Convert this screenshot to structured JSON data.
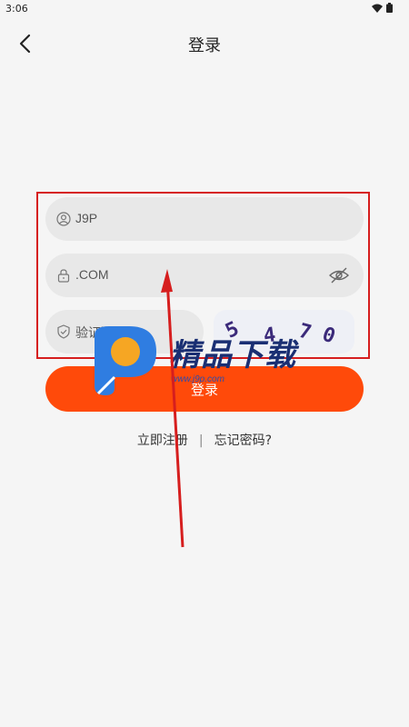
{
  "status_bar": {
    "time": "3:06",
    "icons": [
      "wifi-icon",
      "battery-icon"
    ]
  },
  "header": {
    "back_icon": "chevron-left-icon",
    "title": "登录"
  },
  "form": {
    "username": {
      "icon": "user-icon",
      "value": "J9P"
    },
    "password": {
      "icon": "lock-icon",
      "value": ".COM",
      "toggle_icon": "eye-off-icon"
    },
    "captcha_input": {
      "icon": "shield-icon",
      "placeholder": "验证码"
    },
    "captcha_image": {
      "digits": [
        "5",
        "4",
        "7",
        "0"
      ]
    },
    "login_button": "登录"
  },
  "links": {
    "register": "立即注册",
    "separator": "|",
    "forgot": "忘记密码?"
  },
  "overlay": {
    "watermark_text": "精品下载",
    "watermark_url": "www.j9p.com",
    "highlight_color": "#d61e1e"
  },
  "colors": {
    "accent": "#ff4a0a",
    "background": "#f5f5f5",
    "field_bg": "#e8e8e8"
  }
}
